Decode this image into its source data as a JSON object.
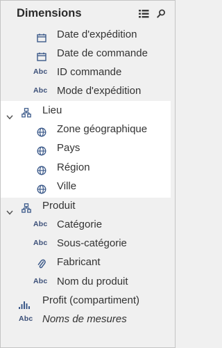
{
  "panel": {
    "title": "Dimensions"
  },
  "items": {
    "date_expedition": "Date d'expédition",
    "date_commande": "Date de commande",
    "id_commande": "ID commande",
    "mode_expedition": "Mode d'expédition",
    "lieu": "Lieu",
    "zone_geo": "Zone géographique",
    "pays": "Pays",
    "region": "Région",
    "ville": "Ville",
    "produit": "Produit",
    "categorie": "Catégorie",
    "sous_categorie": "Sous-catégorie",
    "fabricant": "Fabricant",
    "nom_produit": "Nom du produit",
    "profit_compartiment": "Profit (compartiment)",
    "noms_mesures": "Noms de mesures"
  },
  "badges": {
    "abc": "Abc"
  },
  "icons": {
    "date": "calendar-icon",
    "string": "abc-icon",
    "hierarchy": "hierarchy-icon",
    "geo": "globe-icon",
    "group": "paperclip-icon",
    "bin": "histogram-icon",
    "expanded": "chevron-down-icon",
    "list_view": "list-view-icon",
    "search": "search-icon"
  },
  "colors": {
    "background": "#f0f0f0",
    "highlight": "#ffffff",
    "icon_blue": "#3c5a8a",
    "text": "#333333"
  }
}
